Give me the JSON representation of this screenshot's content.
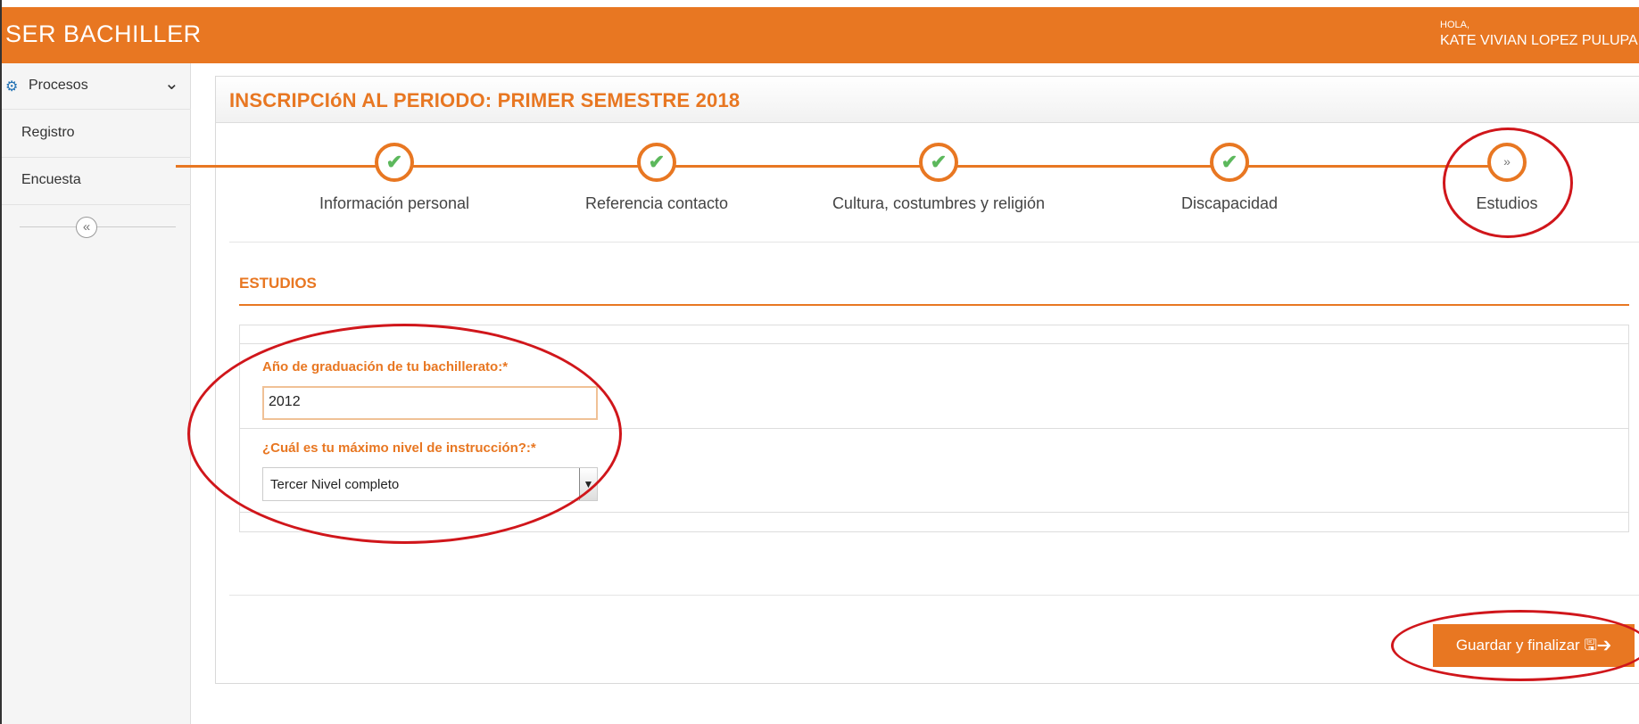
{
  "header": {
    "brand": "SER BACHILLER",
    "greeting": "HOLA,",
    "user_name": "KATE VIVIAN LOPEZ PULUPA"
  },
  "sidebar": {
    "items": [
      {
        "label": "Procesos",
        "icon": "gear-icon"
      },
      {
        "label": "Registro"
      },
      {
        "label": "Encuesta"
      }
    ],
    "collapse_glyph": "«"
  },
  "main": {
    "title": "INSCRIPCIóN AL PERIODO: PRIMER SEMESTRE 2018",
    "steps": [
      {
        "label": "Información personal",
        "status": "done"
      },
      {
        "label": "Referencia contacto",
        "status": "done"
      },
      {
        "label": "Cultura, costumbres y religión",
        "status": "done"
      },
      {
        "label": "Discapacidad",
        "status": "done"
      },
      {
        "label": "Estudios",
        "status": "current"
      }
    ],
    "section_title": "ESTUDIOS",
    "fields": {
      "graduation_year": {
        "label": "Año de graduación de tu bachillerato:*",
        "value": "2012"
      },
      "education_level": {
        "label": "¿Cuál es tu máximo nivel de instrucción?:*",
        "value": "Tercer Nivel completo"
      }
    },
    "save_button": "Guardar y finalizar"
  },
  "colors": {
    "accent": "#E87722",
    "check": "#5cb85c",
    "annotation": "#d0161b"
  }
}
